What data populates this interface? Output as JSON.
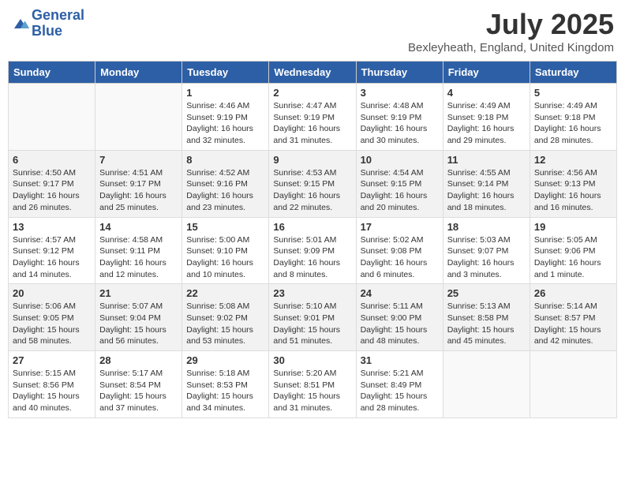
{
  "header": {
    "logo_line1": "General",
    "logo_line2": "Blue",
    "month_title": "July 2025",
    "location": "Bexleyheath, England, United Kingdom"
  },
  "days_of_week": [
    "Sunday",
    "Monday",
    "Tuesday",
    "Wednesday",
    "Thursday",
    "Friday",
    "Saturday"
  ],
  "weeks": [
    [
      {
        "day": "",
        "detail": ""
      },
      {
        "day": "",
        "detail": ""
      },
      {
        "day": "1",
        "detail": "Sunrise: 4:46 AM\nSunset: 9:19 PM\nDaylight: 16 hours\nand 32 minutes."
      },
      {
        "day": "2",
        "detail": "Sunrise: 4:47 AM\nSunset: 9:19 PM\nDaylight: 16 hours\nand 31 minutes."
      },
      {
        "day": "3",
        "detail": "Sunrise: 4:48 AM\nSunset: 9:19 PM\nDaylight: 16 hours\nand 30 minutes."
      },
      {
        "day": "4",
        "detail": "Sunrise: 4:49 AM\nSunset: 9:18 PM\nDaylight: 16 hours\nand 29 minutes."
      },
      {
        "day": "5",
        "detail": "Sunrise: 4:49 AM\nSunset: 9:18 PM\nDaylight: 16 hours\nand 28 minutes."
      }
    ],
    [
      {
        "day": "6",
        "detail": "Sunrise: 4:50 AM\nSunset: 9:17 PM\nDaylight: 16 hours\nand 26 minutes."
      },
      {
        "day": "7",
        "detail": "Sunrise: 4:51 AM\nSunset: 9:17 PM\nDaylight: 16 hours\nand 25 minutes."
      },
      {
        "day": "8",
        "detail": "Sunrise: 4:52 AM\nSunset: 9:16 PM\nDaylight: 16 hours\nand 23 minutes."
      },
      {
        "day": "9",
        "detail": "Sunrise: 4:53 AM\nSunset: 9:15 PM\nDaylight: 16 hours\nand 22 minutes."
      },
      {
        "day": "10",
        "detail": "Sunrise: 4:54 AM\nSunset: 9:15 PM\nDaylight: 16 hours\nand 20 minutes."
      },
      {
        "day": "11",
        "detail": "Sunrise: 4:55 AM\nSunset: 9:14 PM\nDaylight: 16 hours\nand 18 minutes."
      },
      {
        "day": "12",
        "detail": "Sunrise: 4:56 AM\nSunset: 9:13 PM\nDaylight: 16 hours\nand 16 minutes."
      }
    ],
    [
      {
        "day": "13",
        "detail": "Sunrise: 4:57 AM\nSunset: 9:12 PM\nDaylight: 16 hours\nand 14 minutes."
      },
      {
        "day": "14",
        "detail": "Sunrise: 4:58 AM\nSunset: 9:11 PM\nDaylight: 16 hours\nand 12 minutes."
      },
      {
        "day": "15",
        "detail": "Sunrise: 5:00 AM\nSunset: 9:10 PM\nDaylight: 16 hours\nand 10 minutes."
      },
      {
        "day": "16",
        "detail": "Sunrise: 5:01 AM\nSunset: 9:09 PM\nDaylight: 16 hours\nand 8 minutes."
      },
      {
        "day": "17",
        "detail": "Sunrise: 5:02 AM\nSunset: 9:08 PM\nDaylight: 16 hours\nand 6 minutes."
      },
      {
        "day": "18",
        "detail": "Sunrise: 5:03 AM\nSunset: 9:07 PM\nDaylight: 16 hours\nand 3 minutes."
      },
      {
        "day": "19",
        "detail": "Sunrise: 5:05 AM\nSunset: 9:06 PM\nDaylight: 16 hours\nand 1 minute."
      }
    ],
    [
      {
        "day": "20",
        "detail": "Sunrise: 5:06 AM\nSunset: 9:05 PM\nDaylight: 15 hours\nand 58 minutes."
      },
      {
        "day": "21",
        "detail": "Sunrise: 5:07 AM\nSunset: 9:04 PM\nDaylight: 15 hours\nand 56 minutes."
      },
      {
        "day": "22",
        "detail": "Sunrise: 5:08 AM\nSunset: 9:02 PM\nDaylight: 15 hours\nand 53 minutes."
      },
      {
        "day": "23",
        "detail": "Sunrise: 5:10 AM\nSunset: 9:01 PM\nDaylight: 15 hours\nand 51 minutes."
      },
      {
        "day": "24",
        "detail": "Sunrise: 5:11 AM\nSunset: 9:00 PM\nDaylight: 15 hours\nand 48 minutes."
      },
      {
        "day": "25",
        "detail": "Sunrise: 5:13 AM\nSunset: 8:58 PM\nDaylight: 15 hours\nand 45 minutes."
      },
      {
        "day": "26",
        "detail": "Sunrise: 5:14 AM\nSunset: 8:57 PM\nDaylight: 15 hours\nand 42 minutes."
      }
    ],
    [
      {
        "day": "27",
        "detail": "Sunrise: 5:15 AM\nSunset: 8:56 PM\nDaylight: 15 hours\nand 40 minutes."
      },
      {
        "day": "28",
        "detail": "Sunrise: 5:17 AM\nSunset: 8:54 PM\nDaylight: 15 hours\nand 37 minutes."
      },
      {
        "day": "29",
        "detail": "Sunrise: 5:18 AM\nSunset: 8:53 PM\nDaylight: 15 hours\nand 34 minutes."
      },
      {
        "day": "30",
        "detail": "Sunrise: 5:20 AM\nSunset: 8:51 PM\nDaylight: 15 hours\nand 31 minutes."
      },
      {
        "day": "31",
        "detail": "Sunrise: 5:21 AM\nSunset: 8:49 PM\nDaylight: 15 hours\nand 28 minutes."
      },
      {
        "day": "",
        "detail": ""
      },
      {
        "day": "",
        "detail": ""
      }
    ]
  ]
}
